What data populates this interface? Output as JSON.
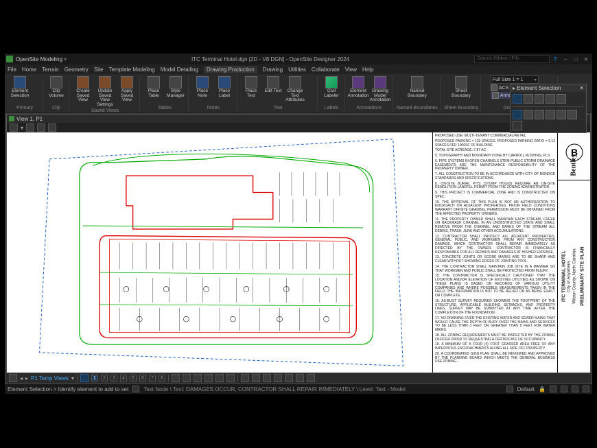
{
  "app": {
    "name": "OpenSite Modeling",
    "title": "ITC Terminal Hotel.dgn [2D - V8 DGN] - OpenSite Designer 2024",
    "search_placeholder": "Search Ribbon (F4)"
  },
  "menubar": [
    "File",
    "Home",
    "Terrain",
    "Geometry",
    "Site",
    "Template Modeling",
    "Model Detailing",
    "Drawing Production",
    "Drawing",
    "Utilities",
    "Collaborate",
    "View",
    "Help"
  ],
  "ribbon_tabs": [
    "Home",
    "Terrain",
    "Geometry",
    "Site",
    "Template Modeling",
    "Model Detailing",
    "Drawing Production",
    "Drawing",
    "Utilities",
    "Collaborate",
    "View",
    "Help"
  ],
  "active_tab": "Drawing Production",
  "ribbon": {
    "groups": [
      {
        "label": "Primary",
        "buttons": [
          {
            "label": "Element Selection"
          }
        ]
      },
      {
        "label": "Clip",
        "buttons": [
          {
            "label": "Clip Volume"
          }
        ]
      },
      {
        "label": "Saved Views",
        "buttons": [
          {
            "label": "Create Saved View"
          },
          {
            "label": "Update Saved View Settings"
          },
          {
            "label": "Apply Saved View"
          }
        ]
      },
      {
        "label": "Tables",
        "buttons": [
          {
            "label": "Place Table"
          },
          {
            "label": "Style Manager"
          }
        ]
      },
      {
        "label": "Notes",
        "buttons": [
          {
            "label": "Place Note"
          },
          {
            "label": "Place Label"
          }
        ]
      },
      {
        "label": "Text",
        "buttons": [
          {
            "label": "Place Text"
          },
          {
            "label": "Edit Text"
          },
          {
            "label": "Change Text Attributes"
          }
        ]
      },
      {
        "label": "Labels",
        "buttons": [
          {
            "label": "Civil Labeler"
          }
        ]
      },
      {
        "label": "Annotations",
        "buttons": [
          {
            "label": "Element Annotation"
          },
          {
            "label": "Drawing Model Annotation"
          }
        ]
      },
      {
        "label": "Named Boundaries",
        "buttons": [
          {
            "label": "Named Boundary"
          }
        ]
      },
      {
        "label": "Sheet Boundary",
        "buttons": [
          {
            "label": "Sheet Boundary"
          }
        ]
      },
      {
        "label": "Drawing Scales",
        "scale_dropdown": "Full Size 1 = 1",
        "acs_lock": "ACS Plane Lock",
        "anno_lock": "Annotation Scale Lock"
      }
    ]
  },
  "palette": {
    "title": "Element Selection"
  },
  "view": {
    "title": "View 1, P1",
    "temp_views": "P1 Temp Views",
    "numbers": [
      1,
      2,
      3,
      4,
      5,
      6,
      7,
      8
    ]
  },
  "titleblock": {
    "project_title": "ITC TERMINAL HOTEL",
    "project_loc1": "City of Anywhere,",
    "project_loc2": "Wilson County, North Carolina",
    "sheet_name": "PRELIMINARY SITE PLAN",
    "logo": "Bentley",
    "notes": [
      "PROPOSED USE: MULTI-TENANT COMMERCIAL/RETAIL",
      "PROPOSED PARKING = 132 SPACES. PROPOSED PARKING RATIO = 5.13 SPACES PER 1000SF OF BUILDING",
      "TOTAL SITE ACREAGE: 7.87 AC",
      "5. TOPOGRAPHY AND BOUNDARY DONE BY CARROLL RUSHING, PLS",
      "6. PIPE SYSTEMS IN OPEN CHANNELS STEM PUBLIC STORM DRAINAGE EASEMENTS ARE THE MAINTENANCE RESPONSIBILITY OF THE PROPERTY OWNER.",
      "7. ALL CONSTRUCTION TO BE IN ACCORDANCE WITH CITY OF MONROE STANDARDS AND SPECIFICATIONS.",
      "8. ON-SITE BURIAL PITS (STUMP HOLES) REQUIRE AN ON-SITE DEMOLITION LANDFILL PERMIT FROM THE ZONING ADMINISTRATOR.",
      "9. THIS PROJECT IS COMMERCIAL ZONE AND IS CONSTRUCTED ON SPEC.",
      "10. THE APPROVAL OF THIS PLAN IS NOT AN AUTHORIZATION TO ENCROACH ON ADJACENT PROPERTIES. PRIOR FIELD CONDITIONS WARRANT OFFSITE GRADING, PERMISSION MUST BE OBTAINED FROM THE AFFECTED PROPERTY OWNERS.",
      "11. THE PROPERTY OWNER SHALL MAINTAIN EACH STREAM, CREEK OR BACKWASH CHANNEL IN AN UNOBSTRUCTED STATE AND SHALL REMOVE FROM THE CHANNEL AND BANKS OF THE STREAM ALL DEBRIS, TRASH, JUNK AND OTHER ACCUMULATIONS.",
      "12. CONTRACTOR SHALL PROTECT ALL ADJACENT PROPERTIES, GENERAL PUBLIC, AND WORKMEN FROM ANY CONSTRUCTION DAMAGE. WHICH CONTRACTOR SHALL REPAIR IMMEDIATELY AS DIRECTED BY THE OWNER. CONTRACTOR IS FINANCIALLY RESPONSIBLE FOR ALL REPAIRS AND DAMAGES AT HIS/HER EXPENSE.",
      "13. CONCRETE JOINTS OR SCORE MARKS ARE TO BE SHARP AND CLEAN WITHOUT SHOWING EDGES OF JOINTING TOOL.",
      "14. THE CONTRACTOR SHALL MAINTAIN JOB SITE IN A MANNER SO THAT WORKMEN AND PUBLIC SHALL BE PROTECTED FROM INJURY.",
      "15. THE CONTRACTOR IS SPECIFICALLY CAUTIONED THAT THE LOCATION AND/OR ELEVATION OF EXISTING UTILITIES AS SHOWN ON THESE PLANS IS BASED ON RECORDS OF VARIOUS UTILITY COMPANIES AND WHERE POSSIBLE MEASUREMENTS TAKEN IN THE FIELD. THE INFORMATION IS NOT TO BE RELIED ON AS BEING EXACT OR COMPLETE.",
      "16. AS-BUILT SURVEY REQUIRED SHOWING THE FOOTPRINT OF THE STRUCTURE, APPLICABLE BUILDING SETBACKS, AND PROPERTY LINES. SURVEY MAY BE SUBMITTED AT ANY TIME AFTER THE COMPLETION OF THE FOUNDATION.",
      "17. NO DRAINING OVER THE EXISTING WATER AND SEWER MAINS THAT WOULD CAUSE THE DEPTH OF BURY OVER THE MAINS AND SERVICES TO BE LESS THAN 3 FEET OR GREATER THAN 8 FEET FOR WATER MAINS.",
      "18. ALL ZONING REQUIREMENTS MUST BE INSPECTED BY THE ZONING OFFICER PRIOR TO REQUESTING A CERTIFICATE OF OCCUPANCY.",
      "19. A MINIMUM OF A FOUR (4) FOOT GRASSED AREA FREE OF ANY IMPERVIOUS ENCROACHMENTS ALONG ALL SIDE OFF PROPERTY.",
      "20. A COORDINATED SIGN PLAN SHALL BE REVIEWED AND APPROVED BY THE PLANNING BOARD WHICH MEETS THE GENERAL BUSINESS USE ZONING."
    ]
  },
  "status": {
    "prompt": "Element Selection > Identify element to add to set",
    "readout": "Text Node \\ Text: DAMAGES OCCUR, CONTRACTOR SHALL REPAIR IMMEDIATELY \\ Level: Text - Model",
    "snap": "Default"
  }
}
